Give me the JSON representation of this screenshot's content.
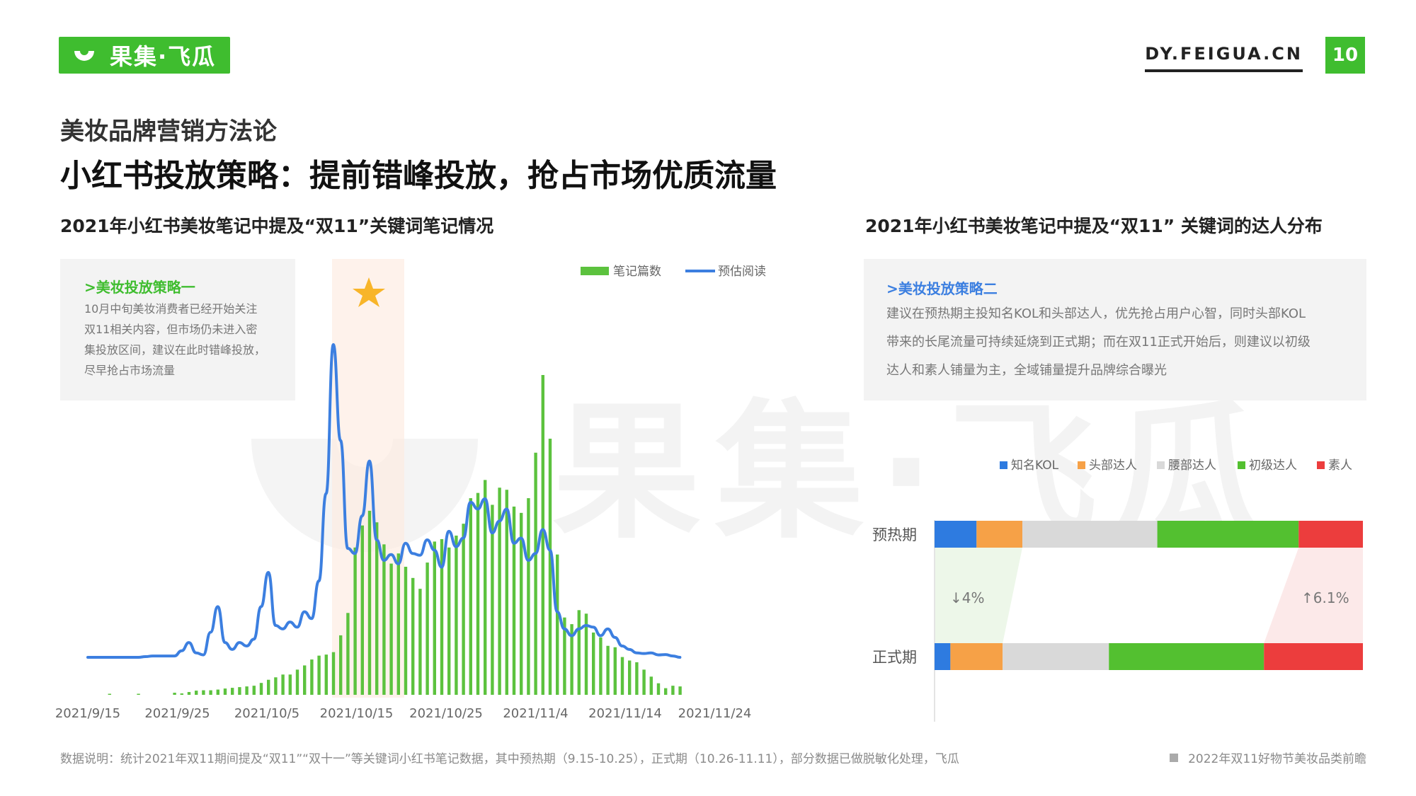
{
  "header": {
    "logo_text": "果集·飞瓜",
    "site": "DY.FEIGUA.CN",
    "page_number": "10",
    "brand_color": "#3fbd2f"
  },
  "section_title": "美妆品牌营销方法论",
  "main_title": "小红书投放策略：提前错峰投放，抢占市场优质流量",
  "left": {
    "title": "2021年小红书美妆笔记中提及“双11”关键词笔记情况",
    "note": {
      "heading": ">美妆投放策略一",
      "lines": [
        "10月中旬美妆消费者已经开始关注",
        "双11相关内容，但市场仍未进入密",
        "集投放区间，建议在此时错峰投放，",
        "尽早抢占市场流量"
      ]
    }
  },
  "right": {
    "title": "2021年小红书美妆笔记中提及“双11” 关键词的达人分布",
    "note": {
      "heading": ">美妆投放策略二",
      "lines": [
        "建议在预热期主投知名KOL和头部达人，优先抢占用户心智，同时头部KOL",
        "带来的长尾流量可持续延烧到正式期；而在双11正式开始后，则建议以初级",
        "达人和素人铺量为主，全域铺量提升品牌综合曝光"
      ]
    },
    "change_down": "↓4%",
    "change_up": "↑6.1%"
  },
  "chart_data": [
    {
      "type": "bar+line",
      "x_ticks": [
        "2021/9/15",
        "2021/9/25",
        "2021/10/5",
        "2021/10/15",
        "2021/10/25",
        "2021/11/4",
        "2021/11/14",
        "2021/11/24"
      ],
      "highlight_period": "2021/10/15",
      "legend_placement": "top-right",
      "series": [
        {
          "name": "笔记篇数",
          "type": "bar",
          "color": "#5cc23e",
          "values": [
            0,
            0,
            0,
            0.3,
            0,
            0,
            0,
            0.3,
            0,
            0,
            0,
            0,
            0.6,
            0.4,
            0.8,
            1.2,
            1.3,
            1.3,
            1.5,
            1.8,
            2.0,
            2.2,
            2.4,
            2.6,
            3.4,
            4.3,
            5.0,
            5.8,
            5.8,
            7.2,
            8.4,
            10.1,
            11.2,
            11.5,
            12.2,
            17.0,
            23.4,
            42.1,
            48.4,
            52.6,
            49.3,
            43.0,
            37.5,
            40.4,
            36.6,
            33.4,
            30.3,
            37.8,
            43.8,
            44.5,
            42.1,
            45.5,
            48.9,
            56.2,
            57.7,
            61.4,
            54.3,
            59.2,
            58.6,
            53.8,
            52.0,
            56.2,
            69.2,
            91.4,
            73.2,
            40.1,
            22.1,
            20.2,
            24.2,
            23.2,
            17.8,
            16.4,
            14.0,
            13.6,
            10.8,
            9.8,
            9.3,
            7.2,
            5.2,
            3.3,
            1.9,
            2.6,
            2.4
          ]
        },
        {
          "name": "预估阅读",
          "type": "line",
          "color": "#3c7fe0",
          "values": [
            8.7,
            8.7,
            8.7,
            8.7,
            8.7,
            8.7,
            8.7,
            8.7,
            8.9,
            9.1,
            9.1,
            9.1,
            9.1,
            10.6,
            13.0,
            10.0,
            9.4,
            16.0,
            23.5,
            13.0,
            11.0,
            13.0,
            12.0,
            14.0,
            23.5,
            33.5,
            18.0,
            17.0,
            19.0,
            17.5,
            22.0,
            20.0,
            31.0,
            56.5,
            100.0,
            72.0,
            40.5,
            39.0,
            50.0,
            66.0,
            43.0,
            37.0,
            38.7,
            36.0,
            42.0,
            39.0,
            38.5,
            43.0,
            40.0,
            35.0,
            45.5,
            41.0,
            43.5,
            54.0,
            52.0,
            55.0,
            45.0,
            48.5,
            52.0,
            42.0,
            43.5,
            37.0,
            39.0,
            46.0,
            40.0,
            22.0,
            17.0,
            15.0,
            17.0,
            18.0,
            17.5,
            15.0,
            17.0,
            14.5,
            12.0,
            11.0,
            10.0,
            9.8,
            10.0,
            9.4,
            9.5,
            9.1,
            8.7
          ]
        }
      ]
    },
    {
      "type": "stacked-bar-horizontal",
      "categories": [
        "预热期",
        "正式期"
      ],
      "legend_placement": "top-right",
      "series": [
        {
          "name": "知名KOL",
          "color": "#2e7be0",
          "values": [
            9.8,
            3.7
          ]
        },
        {
          "name": "头部达人",
          "color": "#f6a147",
          "values": [
            10.7,
            12.2
          ]
        },
        {
          "name": "腰部达人",
          "color": "#d9d9d9",
          "values": [
            31.5,
            24.8
          ]
        },
        {
          "name": "初级达人",
          "color": "#53c030",
          "values": [
            33.0,
            36.2
          ]
        },
        {
          "name": "素人",
          "color": "#ec3d3d",
          "values": [
            15.0,
            23.1
          ]
        }
      ]
    }
  ],
  "footer": {
    "note": "数据说明：统计2021年双11期间提及“双11”“双十一”等关键词小红书笔记数据，其中预热期（9.15-10.25），正式期（10.26-11.11），部分数据已做脱敏化处理，飞瓜",
    "report": "2022年双11好物节美妆品类前瞻"
  }
}
